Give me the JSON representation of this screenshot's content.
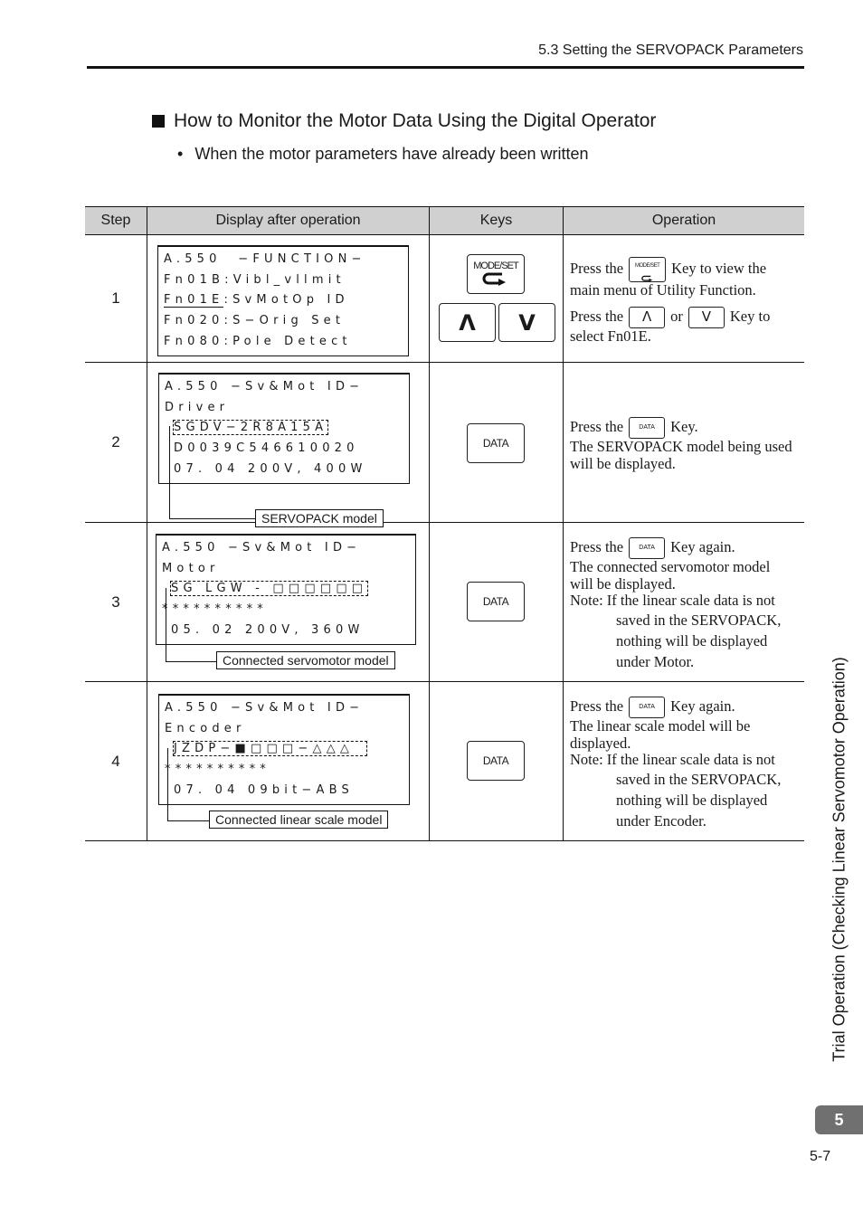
{
  "header": {
    "running_head": "5.3  Setting the SERVOPACK Parameters"
  },
  "section": {
    "title": "How to Monitor the Motor Data Using the Digital Operator",
    "subtitle_bullet": "•",
    "subtitle": "When the motor parameters have already been written"
  },
  "table": {
    "headers": [
      "Step",
      "Display after operation",
      "Keys",
      "Operation"
    ],
    "rows": [
      {
        "step": "1",
        "display": {
          "lines": [
            "A.550  −FUNCTION−",
            "Fn01B:Vibl_vllmit",
            "Fn01E:SvMotOp ID",
            "Fn020:S−Orig Set",
            "Fn080:Pole Detect"
          ],
          "underlined_prefix": "Fn01E"
        },
        "keys": {
          "mode_set": "MODE/SET",
          "up": "Λ",
          "down": "V"
        },
        "operation": {
          "p1_pre": "Press the",
          "p1_key": "MODE/SET",
          "p1_post": "Key to view the main menu of Utility Function.",
          "p2_pre": "Press the",
          "p2_key_up": "Λ",
          "p2_mid": "or",
          "p2_key_down": "V",
          "p2_post": "Key to select Fn01E."
        }
      },
      {
        "step": "2",
        "display": {
          "lines": [
            "A.550 −Sv&Mot ID−",
            "Driver",
            "SGDV−2R8A15A",
            "D0039C546610020",
            "07. 04 200V, 400W"
          ],
          "callout": "SERVOPACK model"
        },
        "keys": {
          "data": "DATA"
        },
        "operation": {
          "pre": "Press the",
          "key": "DATA",
          "post": "Key.",
          "desc": "The SERVOPACK model being used will be displayed."
        }
      },
      {
        "step": "3",
        "display": {
          "lines": [
            "A.550 −Sv&Mot ID−",
            "Motor",
            "SG LGW - □□□□□□",
            "**********",
            "05. 02 200V, 360W"
          ],
          "callout": "Connected servomotor model"
        },
        "keys": {
          "data": "DATA"
        },
        "operation": {
          "pre": "Press the",
          "key": "DATA",
          "post": "Key again.",
          "desc": "The connected servomotor model will be displayed.",
          "note_label": "Note:",
          "note_first": "If the linear scale data is not",
          "note_rest": [
            "saved in the SERVOPACK,",
            "nothing will be displayed",
            "under Motor."
          ]
        }
      },
      {
        "step": "4",
        "display": {
          "lines": [
            "A.550 −Sv&Mot ID−",
            "Encoder",
            "JZDP−■□□□−△△△",
            "**********",
            "07. 04 09bit−ABS"
          ],
          "callout": "Connected linear scale model"
        },
        "keys": {
          "data": "DATA"
        },
        "operation": {
          "pre": "Press the",
          "key": "DATA",
          "post": "Key again.",
          "desc": "The linear scale model will be displayed.",
          "note_label": "Note:",
          "note_first": "If the linear scale data is not",
          "note_rest": [
            "saved in the SERVOPACK,",
            "nothing will be displayed",
            "under Encoder."
          ]
        }
      }
    ]
  },
  "side_tab": {
    "text": "Trial Operation (Checking Linear Servomotor Operation)",
    "chapter": "5"
  },
  "footer": {
    "page_number": "5-7"
  }
}
